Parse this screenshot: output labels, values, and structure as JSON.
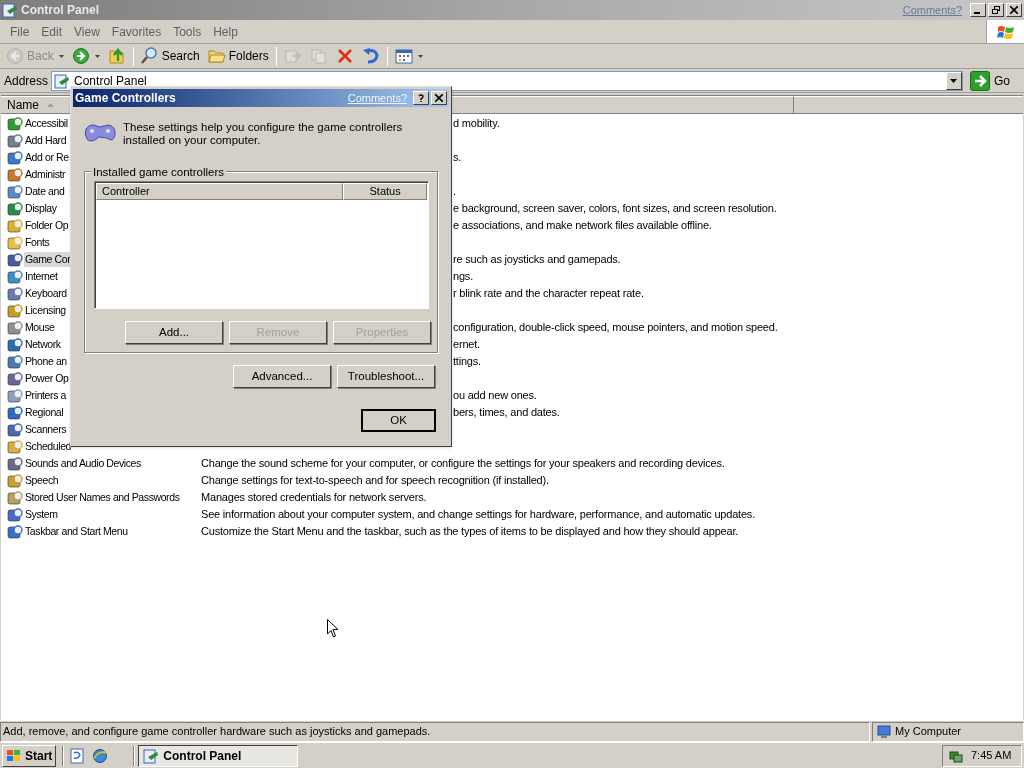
{
  "window": {
    "title": "Control Panel",
    "comments_link": "Comments?"
  },
  "menu": [
    "File",
    "Edit",
    "View",
    "Favorites",
    "Tools",
    "Help"
  ],
  "toolbar": [
    {
      "kind": "back",
      "label": "Back",
      "disabled": true
    },
    {
      "kind": "forward",
      "disabled": false
    },
    {
      "kind": "up",
      "disabled": false
    },
    {
      "kind": "search",
      "label": "Search",
      "disabled": false
    },
    {
      "kind": "folders",
      "label": "Folders",
      "disabled": false
    },
    {
      "kind": "move",
      "disabled": true
    },
    {
      "kind": "copy",
      "disabled": true
    },
    {
      "kind": "delete",
      "disabled": false
    },
    {
      "kind": "undo",
      "disabled": false
    },
    {
      "kind": "views",
      "disabled": false
    }
  ],
  "address": {
    "label": "Address",
    "value": "Control Panel",
    "go": "Go"
  },
  "list": {
    "columns": [
      "Name"
    ],
    "rows": [
      {
        "name": "Accessibil",
        "description": "d mobility.",
        "selected": false
      },
      {
        "name": "Add Hard",
        "selected": false
      },
      {
        "name": "Add or Re",
        "description": "s.",
        "selected": false
      },
      {
        "name": "Administr",
        "selected": false
      },
      {
        "name": "Date and",
        "description": ".",
        "selected": false
      },
      {
        "name": "Display",
        "description": "e background, screen saver, colors, font sizes, and screen resolution.",
        "selected": false
      },
      {
        "name": "Folder Op",
        "description": "e associations, and make network files available offline.",
        "selected": false
      },
      {
        "name": "Fonts",
        "selected": false
      },
      {
        "name": "Game Cor",
        "description": "re such as joysticks and gamepads.",
        "selected": true
      },
      {
        "name": "Internet",
        "description": "ngs.",
        "selected": false
      },
      {
        "name": "Keyboard",
        "description": "r blink rate and the character repeat rate.",
        "selected": false
      },
      {
        "name": "Licensing",
        "selected": false
      },
      {
        "name": "Mouse",
        "description": "configuration, double-click speed, mouse pointers, and motion speed.",
        "selected": false
      },
      {
        "name": "Network",
        "description": "ernet.",
        "selected": false
      },
      {
        "name": "Phone an",
        "description": "ttings.",
        "selected": false
      },
      {
        "name": "Power Op",
        "selected": false
      },
      {
        "name": "Printers a",
        "description": "ou add new ones.",
        "selected": false
      },
      {
        "name": "Regional",
        "description": "bers, times, and dates.",
        "selected": false
      },
      {
        "name": "Scanners",
        "selected": false
      },
      {
        "name": "Scheduled",
        "selected": false
      },
      {
        "name": "Sounds and Audio Devices",
        "description": "Change the sound scheme for your computer, or configure the settings for your speakers and recording devices.",
        "selected": false
      },
      {
        "name": "Speech",
        "description": "Change settings for text-to-speech and for speech recognition (if installed).",
        "selected": false
      },
      {
        "name": "Stored User Names and Passwords",
        "description": "Manages stored credentials for network servers.",
        "selected": false
      },
      {
        "name": "System",
        "description": "See information about your computer system, and change settings for hardware, performance, and automatic updates.",
        "selected": false
      },
      {
        "name": "Taskbar and Start Menu",
        "description": "Customize the Start Menu and the taskbar, such as the types of items to be displayed and how they should appear.",
        "selected": false
      }
    ]
  },
  "dialog": {
    "title": "Game Controllers",
    "comments_link": "Comments?",
    "intro": "These settings help you configure the game controllers installed on your computer.",
    "group_label": "Installed game controllers",
    "columns": [
      "Controller",
      "Status"
    ],
    "group_buttons": [
      {
        "label": "Add...",
        "disabled": false
      },
      {
        "label": "Remove",
        "disabled": true
      },
      {
        "label": "Properties",
        "disabled": true
      }
    ],
    "buttons": [
      {
        "label": "Advanced...",
        "default": false
      },
      {
        "label": "Troubleshoot...",
        "default": false
      }
    ],
    "ok": {
      "label": "OK",
      "default": true
    }
  },
  "status_bar": {
    "text": "Add, remove, and configure game controller hardware such as joysticks and gamepads.",
    "zone": "My Computer"
  },
  "taskbar": {
    "start": "Start",
    "tasks": [
      {
        "label": "Control Panel",
        "selected": true
      }
    ],
    "clock": "7:45 AM"
  }
}
